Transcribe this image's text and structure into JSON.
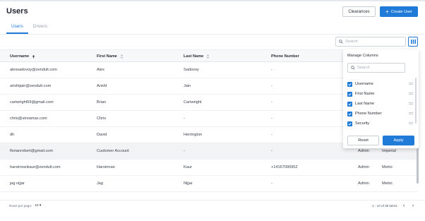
{
  "header": {
    "title": "Users",
    "clearances_label": "Clearances",
    "create_user_label": "Create User"
  },
  "tabs": [
    {
      "label": "Users",
      "active": true
    },
    {
      "label": "Drivers",
      "active": false
    }
  ],
  "search": {
    "placeholder": "Search"
  },
  "table": {
    "columns": {
      "username": "Username",
      "first_name": "First Name",
      "last_name": "Last Name",
      "phone": "Phone Number"
    },
    "rows": [
      {
        "username": "alexsadovoy@zendult.com",
        "first_name": "Alex",
        "last_name": "Sadovoy",
        "phone": "-",
        "role": "",
        "units": ""
      },
      {
        "username": "arishtjain@zendult.com",
        "first_name": "Arisht",
        "last_name": "Jain",
        "phone": "-",
        "role": "",
        "units": ""
      },
      {
        "username": "cartwright59@gmail.com",
        "first_name": "Brian",
        "last_name": "Cartwright",
        "phone": "-",
        "role": "",
        "units": ""
      },
      {
        "username": "chris@streamax.com",
        "first_name": "Chris",
        "last_name": "-",
        "phone": "-",
        "role": "",
        "units": ""
      },
      {
        "username": "dh",
        "first_name": "David",
        "last_name": "Herrington",
        "phone": "-",
        "role": "",
        "units": ""
      },
      {
        "username": "florianrobert@gmail.com",
        "first_name": "Customer Account",
        "last_name": "-",
        "phone": "-",
        "role": "Admin",
        "units": "Imperial"
      },
      {
        "username": "harsimrankaur@zendult.com",
        "first_name": "Harsimran",
        "last_name": "Kaur",
        "phone": "+14167090952",
        "role": "Admin",
        "units": "Metric"
      },
      {
        "username": "jag nijjar",
        "first_name": "Jag",
        "last_name": "Nijjar",
        "phone": "-",
        "role": "Admin",
        "units": "Metric"
      }
    ],
    "highlight_row": 5
  },
  "footer": {
    "rows_per_page_label": "Rows per page:",
    "rows_per_page_value": "10",
    "page_info": "1 - 10 of 35 items"
  },
  "manage_columns": {
    "title": "Manage Columns",
    "search_placeholder": "Search",
    "options": [
      {
        "label": "Username",
        "checked": true
      },
      {
        "label": "First Name",
        "checked": true
      },
      {
        "label": "Last Name",
        "checked": true
      },
      {
        "label": "Phone Number",
        "checked": true
      },
      {
        "label": "Security",
        "checked": true
      }
    ],
    "reset_label": "Reset",
    "apply_label": "Apply"
  },
  "colors": {
    "accent": "#1f7ad8",
    "highlight_row": "#f2f3f5"
  }
}
